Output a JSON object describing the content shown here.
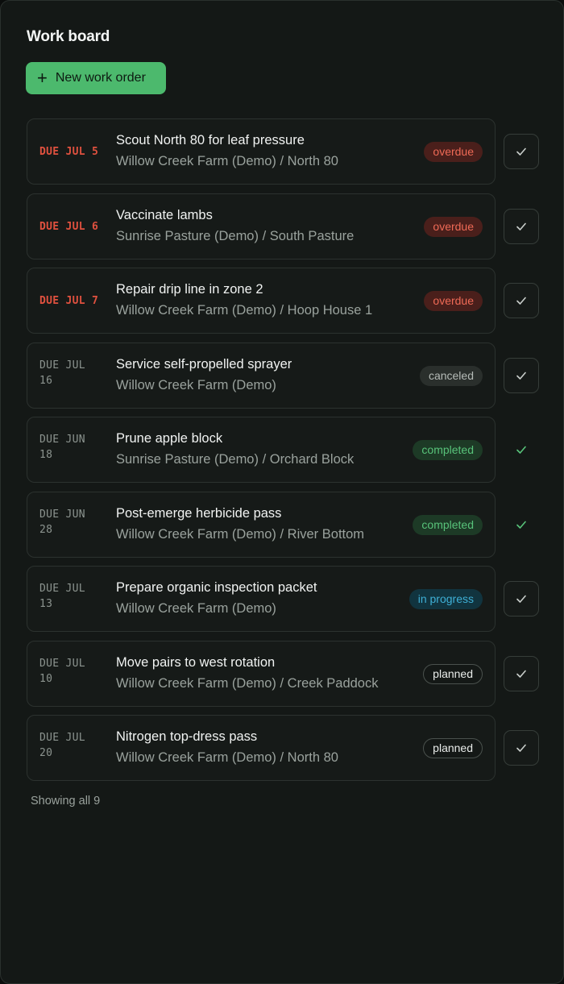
{
  "header": {
    "title": "Work board",
    "new_button_label": "New work order",
    "new_button_icon": "plus-icon"
  },
  "colors": {
    "accent": "#4cb96d",
    "overdue": "#e0513f",
    "completed": "#58c37a",
    "in_progress": "#3fb0d6"
  },
  "work_orders": [
    {
      "due_line1": "DUE JUL 5",
      "due_line2": "",
      "due_overdue": true,
      "title": "Scout North 80 for leaf pressure",
      "location": "Willow Creek Farm (Demo) / North 80",
      "status": "overdue",
      "status_class": "overdue",
      "done": false
    },
    {
      "due_line1": "DUE JUL 6",
      "due_line2": "",
      "due_overdue": true,
      "title": "Vaccinate lambs",
      "location": "Sunrise Pasture (Demo) / South Pasture",
      "status": "overdue",
      "status_class": "overdue",
      "done": false
    },
    {
      "due_line1": "DUE JUL 7",
      "due_line2": "",
      "due_overdue": true,
      "title": "Repair drip line in zone 2",
      "location": "Willow Creek Farm (Demo) / Hoop House 1",
      "status": "overdue",
      "status_class": "overdue",
      "done": false
    },
    {
      "due_line1": "DUE JUL",
      "due_line2": "16",
      "due_overdue": false,
      "title": "Service self-propelled sprayer",
      "location": "Willow Creek Farm (Demo)",
      "status": "canceled",
      "status_class": "canceled",
      "done": false
    },
    {
      "due_line1": "DUE JUN",
      "due_line2": "18",
      "due_overdue": false,
      "title": "Prune apple block",
      "location": "Sunrise Pasture (Demo) / Orchard Block",
      "status": "completed",
      "status_class": "completed",
      "done": true
    },
    {
      "due_line1": "DUE JUN",
      "due_line2": "28",
      "due_overdue": false,
      "title": "Post-emerge herbicide pass",
      "location": "Willow Creek Farm (Demo) / River Bottom",
      "status": "completed",
      "status_class": "completed",
      "done": true
    },
    {
      "due_line1": "DUE JUL",
      "due_line2": "13",
      "due_overdue": false,
      "title": "Prepare organic inspection packet",
      "location": "Willow Creek Farm (Demo)",
      "status": "in progress",
      "status_class": "in-progress",
      "done": false
    },
    {
      "due_line1": "DUE JUL",
      "due_line2": "10",
      "due_overdue": false,
      "title": "Move pairs to west rotation",
      "location": "Willow Creek Farm (Demo) / Creek Paddock",
      "status": "planned",
      "status_class": "planned",
      "done": false
    },
    {
      "due_line1": "DUE JUL",
      "due_line2": "20",
      "due_overdue": false,
      "title": "Nitrogen top-dress pass",
      "location": "Willow Creek Farm (Demo) / North 80",
      "status": "planned",
      "status_class": "planned",
      "done": false
    }
  ],
  "footer": {
    "count_text": "Showing all 9"
  }
}
